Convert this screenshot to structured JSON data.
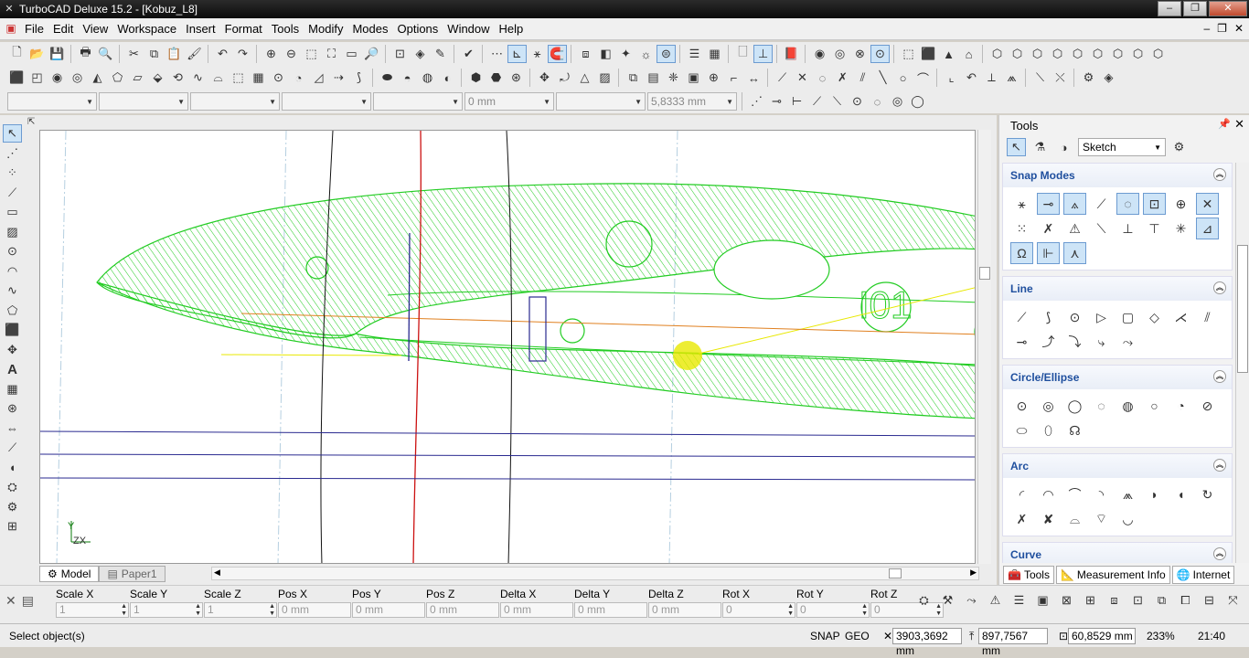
{
  "window": {
    "title": "TurboCAD Deluxe 15.2 - [Kobuz_L8]"
  },
  "menu": [
    "File",
    "Edit",
    "View",
    "Workspace",
    "Insert",
    "Format",
    "Tools",
    "Modify",
    "Modes",
    "Options",
    "Window",
    "Help"
  ],
  "toolbar3": {
    "combo5_value": "0 mm",
    "combo7_value": "5,8333 mm"
  },
  "canvas": {
    "hatch_label": "I01",
    "ucs_label": "ZX"
  },
  "tabs": [
    "Model",
    "Paper1"
  ],
  "palette": {
    "header": "Tools",
    "mode_value": "Sketch",
    "sections": [
      "Snap Modes",
      "Line",
      "Circle/Ellipse",
      "Arc",
      "Curve"
    ],
    "bottom_tabs": [
      "Tools",
      "Measurement Info",
      "Internet"
    ]
  },
  "inspector": {
    "fields": [
      {
        "label": "Scale X",
        "value": "1"
      },
      {
        "label": "Scale Y",
        "value": "1"
      },
      {
        "label": "Scale Z",
        "value": "1"
      },
      {
        "label": "Pos X",
        "value": "0 mm"
      },
      {
        "label": "Pos Y",
        "value": "0 mm"
      },
      {
        "label": "Pos Z",
        "value": "0 mm"
      },
      {
        "label": "Delta X",
        "value": "0 mm"
      },
      {
        "label": "Delta Y",
        "value": "0 mm"
      },
      {
        "label": "Delta Z",
        "value": "0 mm"
      },
      {
        "label": "Rot X",
        "value": "0"
      },
      {
        "label": "Rot Y",
        "value": "0"
      },
      {
        "label": "Rot Z",
        "value": "0"
      }
    ]
  },
  "status": {
    "message": "Select object(s)",
    "snap": "SNAP",
    "geo": "GEO",
    "coord_x": "3903,3692 mm",
    "coord_y": "897,7567 mm",
    "coord_z": "60,8529 mm",
    "zoom": "233%",
    "time": "21:40"
  },
  "colors": {
    "hatch": "#22cc22",
    "accent": "#1f4f9e",
    "guide_red": "#cc1111",
    "guide_blue": "#2a2a90",
    "guide_orange": "#e08020",
    "guide_yellow": "#e8e800"
  }
}
